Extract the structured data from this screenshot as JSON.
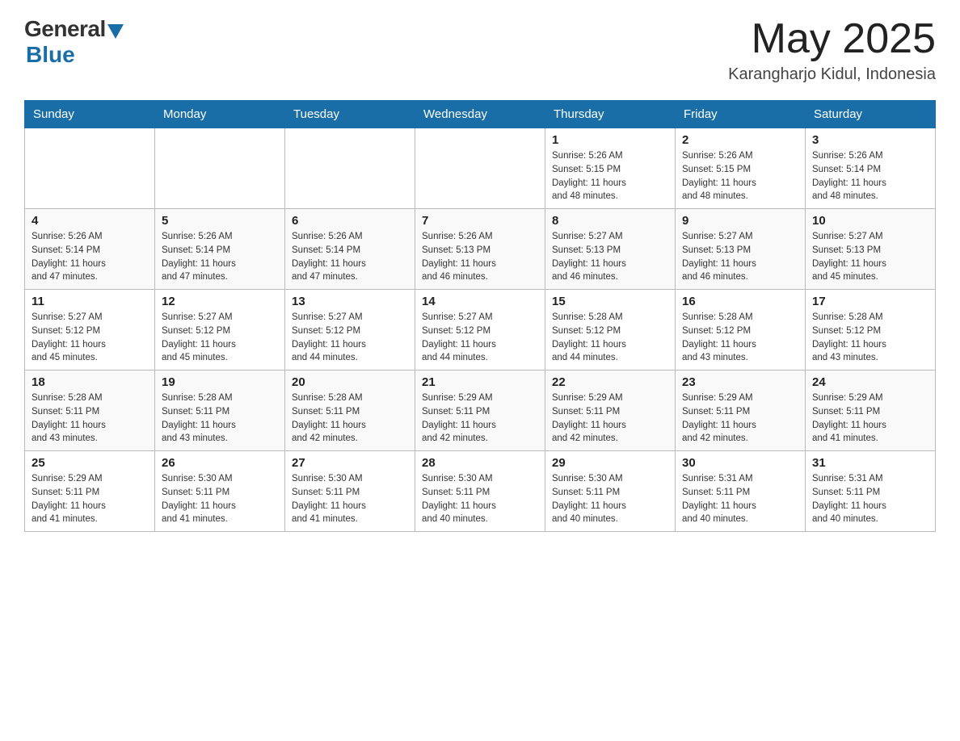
{
  "header": {
    "logo_general": "General",
    "logo_blue": "Blue",
    "month_title": "May 2025",
    "location": "Karangharjo Kidul, Indonesia"
  },
  "weekdays": [
    "Sunday",
    "Monday",
    "Tuesday",
    "Wednesday",
    "Thursday",
    "Friday",
    "Saturday"
  ],
  "weeks": [
    [
      {
        "day": "",
        "info": ""
      },
      {
        "day": "",
        "info": ""
      },
      {
        "day": "",
        "info": ""
      },
      {
        "day": "",
        "info": ""
      },
      {
        "day": "1",
        "info": "Sunrise: 5:26 AM\nSunset: 5:15 PM\nDaylight: 11 hours\nand 48 minutes."
      },
      {
        "day": "2",
        "info": "Sunrise: 5:26 AM\nSunset: 5:15 PM\nDaylight: 11 hours\nand 48 minutes."
      },
      {
        "day": "3",
        "info": "Sunrise: 5:26 AM\nSunset: 5:14 PM\nDaylight: 11 hours\nand 48 minutes."
      }
    ],
    [
      {
        "day": "4",
        "info": "Sunrise: 5:26 AM\nSunset: 5:14 PM\nDaylight: 11 hours\nand 47 minutes."
      },
      {
        "day": "5",
        "info": "Sunrise: 5:26 AM\nSunset: 5:14 PM\nDaylight: 11 hours\nand 47 minutes."
      },
      {
        "day": "6",
        "info": "Sunrise: 5:26 AM\nSunset: 5:14 PM\nDaylight: 11 hours\nand 47 minutes."
      },
      {
        "day": "7",
        "info": "Sunrise: 5:26 AM\nSunset: 5:13 PM\nDaylight: 11 hours\nand 46 minutes."
      },
      {
        "day": "8",
        "info": "Sunrise: 5:27 AM\nSunset: 5:13 PM\nDaylight: 11 hours\nand 46 minutes."
      },
      {
        "day": "9",
        "info": "Sunrise: 5:27 AM\nSunset: 5:13 PM\nDaylight: 11 hours\nand 46 minutes."
      },
      {
        "day": "10",
        "info": "Sunrise: 5:27 AM\nSunset: 5:13 PM\nDaylight: 11 hours\nand 45 minutes."
      }
    ],
    [
      {
        "day": "11",
        "info": "Sunrise: 5:27 AM\nSunset: 5:12 PM\nDaylight: 11 hours\nand 45 minutes."
      },
      {
        "day": "12",
        "info": "Sunrise: 5:27 AM\nSunset: 5:12 PM\nDaylight: 11 hours\nand 45 minutes."
      },
      {
        "day": "13",
        "info": "Sunrise: 5:27 AM\nSunset: 5:12 PM\nDaylight: 11 hours\nand 44 minutes."
      },
      {
        "day": "14",
        "info": "Sunrise: 5:27 AM\nSunset: 5:12 PM\nDaylight: 11 hours\nand 44 minutes."
      },
      {
        "day": "15",
        "info": "Sunrise: 5:28 AM\nSunset: 5:12 PM\nDaylight: 11 hours\nand 44 minutes."
      },
      {
        "day": "16",
        "info": "Sunrise: 5:28 AM\nSunset: 5:12 PM\nDaylight: 11 hours\nand 43 minutes."
      },
      {
        "day": "17",
        "info": "Sunrise: 5:28 AM\nSunset: 5:12 PM\nDaylight: 11 hours\nand 43 minutes."
      }
    ],
    [
      {
        "day": "18",
        "info": "Sunrise: 5:28 AM\nSunset: 5:11 PM\nDaylight: 11 hours\nand 43 minutes."
      },
      {
        "day": "19",
        "info": "Sunrise: 5:28 AM\nSunset: 5:11 PM\nDaylight: 11 hours\nand 43 minutes."
      },
      {
        "day": "20",
        "info": "Sunrise: 5:28 AM\nSunset: 5:11 PM\nDaylight: 11 hours\nand 42 minutes."
      },
      {
        "day": "21",
        "info": "Sunrise: 5:29 AM\nSunset: 5:11 PM\nDaylight: 11 hours\nand 42 minutes."
      },
      {
        "day": "22",
        "info": "Sunrise: 5:29 AM\nSunset: 5:11 PM\nDaylight: 11 hours\nand 42 minutes."
      },
      {
        "day": "23",
        "info": "Sunrise: 5:29 AM\nSunset: 5:11 PM\nDaylight: 11 hours\nand 42 minutes."
      },
      {
        "day": "24",
        "info": "Sunrise: 5:29 AM\nSunset: 5:11 PM\nDaylight: 11 hours\nand 41 minutes."
      }
    ],
    [
      {
        "day": "25",
        "info": "Sunrise: 5:29 AM\nSunset: 5:11 PM\nDaylight: 11 hours\nand 41 minutes."
      },
      {
        "day": "26",
        "info": "Sunrise: 5:30 AM\nSunset: 5:11 PM\nDaylight: 11 hours\nand 41 minutes."
      },
      {
        "day": "27",
        "info": "Sunrise: 5:30 AM\nSunset: 5:11 PM\nDaylight: 11 hours\nand 41 minutes."
      },
      {
        "day": "28",
        "info": "Sunrise: 5:30 AM\nSunset: 5:11 PM\nDaylight: 11 hours\nand 40 minutes."
      },
      {
        "day": "29",
        "info": "Sunrise: 5:30 AM\nSunset: 5:11 PM\nDaylight: 11 hours\nand 40 minutes."
      },
      {
        "day": "30",
        "info": "Sunrise: 5:31 AM\nSunset: 5:11 PM\nDaylight: 11 hours\nand 40 minutes."
      },
      {
        "day": "31",
        "info": "Sunrise: 5:31 AM\nSunset: 5:11 PM\nDaylight: 11 hours\nand 40 minutes."
      }
    ]
  ]
}
